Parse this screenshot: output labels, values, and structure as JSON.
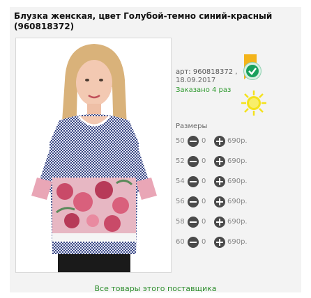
{
  "product": {
    "title": "Блузка женская, цвет Голубой-темно синий-красный (960818372)",
    "article": "арт: 960818372 ,",
    "date": "18.09.2017",
    "ordered": "Заказано 4 раз",
    "image_label": "blouse-photo"
  },
  "sizes": {
    "title": "Размеры",
    "rows": [
      {
        "size": "50",
        "qty": "0",
        "price": "690р."
      },
      {
        "size": "52",
        "qty": "0",
        "price": "690р."
      },
      {
        "size": "54",
        "qty": "0",
        "price": "690р."
      },
      {
        "size": "56",
        "qty": "0",
        "price": "690р."
      },
      {
        "size": "58",
        "qty": "0",
        "price": "690р."
      },
      {
        "size": "60",
        "qty": "0",
        "price": "690р."
      }
    ]
  },
  "footer": {
    "supplier_link": "Все товары этого поставщика"
  },
  "icons": {
    "bookmark": "bookmark-icon",
    "check": "check-badge-icon",
    "sun": "sun-icon",
    "minus": "minus-circle-icon",
    "plus": "plus-circle-icon"
  },
  "colors": {
    "background": "#f3f3f3",
    "link_green": "#2f8f2f",
    "ordered_green": "#2f9a2f",
    "bookmark_yellow": "#f3b41b",
    "check_green": "#19a05c",
    "sun_yellow": "#f4e21b"
  }
}
